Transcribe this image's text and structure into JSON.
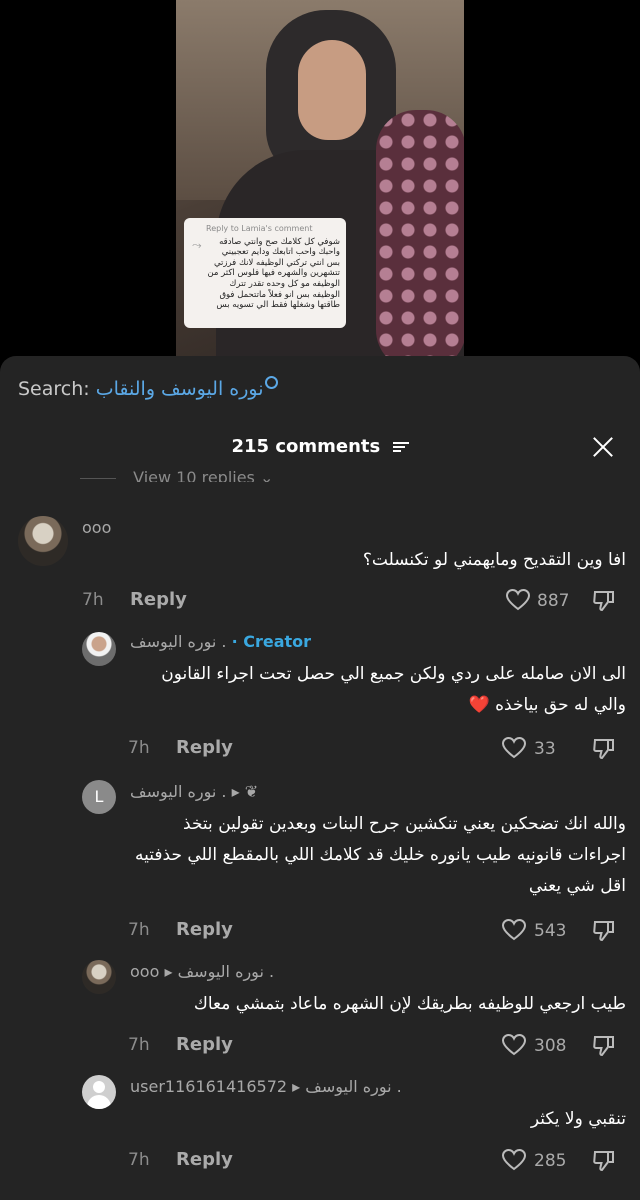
{
  "video": {
    "reply_card": {
      "title": "Reply to Lamia's comment",
      "text": "شوفي كل كلامك صح وانتي صادقه واحبك واحب اتابعك ودايم تعجبيني بس انتي تركتي الوظيفه لانك فرزتي تتشهرين والشهره فيها فلوس اكثر من الوظيفه مو كل وحده تقدر تترك الوظيفه بس انو فعلاً ماتتحمل فوق طاقتها وشغلها فقط الي تسويه بس"
    }
  },
  "search": {
    "label": "Search:",
    "query": "نوره اليوسف والنقاب"
  },
  "header": {
    "title": "215 comments"
  },
  "view_more": "View 10 replies",
  "comments": [
    {
      "name": "ooo",
      "text": "افا وين التقديح ومايهمني لو تكنسلت؟",
      "time": "7h",
      "reply": "Reply",
      "likes": "887"
    },
    {
      "name": "نوره اليوسف .",
      "creator": "· Creator",
      "text": "الى الان صامله على ردي ولكن جميع الي حصل تحت اجراء القانون والي له حق بياخذه ❤️",
      "time": "7h",
      "reply": "Reply",
      "likes": "33"
    },
    {
      "name": "نوره اليوسف .",
      "avatar_letter": "L",
      "text": "والله انك تضحكين يعني تنكشين جرح البنات وبعدين تقولين بتخذ اجراءات قانونيه طيب يانوره خليك قد كلامك اللي بالمقطع اللي حذفتيه اقل شي يعني",
      "time": "7h",
      "reply": "Reply",
      "likes": "543"
    },
    {
      "name": "ooo",
      "to": "نوره اليوسف .",
      "text": "طيب ارجعي للوظيفه بطريقك لإن الشهره ماعاد بتمشي معاك",
      "time": "7h",
      "reply": "Reply",
      "likes": "308"
    },
    {
      "name": "user116161416572",
      "to": "نوره اليوسف .",
      "text": "تنقبي ولا يكثر",
      "time": "7h",
      "reply": "Reply",
      "likes": "285"
    }
  ],
  "colors": {
    "sheet": "#242424",
    "accent": "#5ba8e6",
    "creator": "#3aa8e0",
    "heart": "#ff2d3d"
  }
}
